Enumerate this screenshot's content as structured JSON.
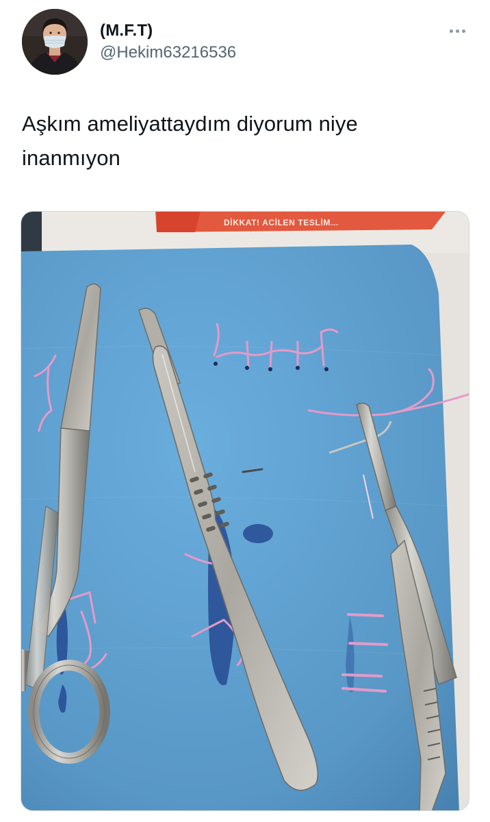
{
  "author": {
    "display_name": "(M.F.T)",
    "handle": "@Hekim63216536"
  },
  "tweet": {
    "text": "Aşkım ameliyattaydım diyorum niye\ninanmıyon"
  },
  "media": {
    "banner_text": "DİKKAT! ACİLEN TESLİM..."
  },
  "icons": {
    "more": "more-horizontal-icon"
  },
  "colors": {
    "secondary_text": "#536471",
    "sponge_blue": "#5b9fcf",
    "suture_pink": "#e59ac8"
  }
}
